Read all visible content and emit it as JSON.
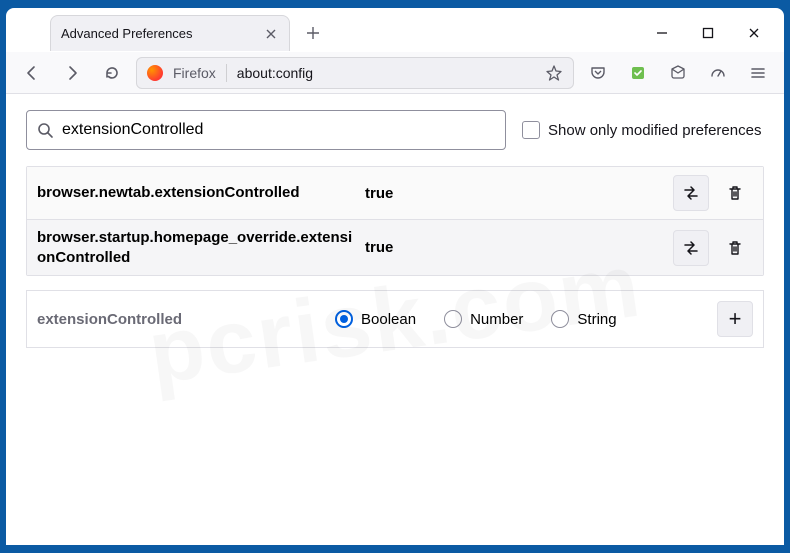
{
  "tab": {
    "title": "Advanced Preferences"
  },
  "urlbar": {
    "brand": "Firefox",
    "url": "about:config"
  },
  "search": {
    "value": "extensionControlled",
    "show_modified_label": "Show only modified preferences"
  },
  "prefs": [
    {
      "name": "browser.newtab.extensionControlled",
      "value": "true"
    },
    {
      "name": "browser.startup.homepage_override.extensionControlled",
      "value": "true"
    }
  ],
  "newpref": {
    "name": "extensionControlled",
    "options": {
      "boolean": "Boolean",
      "number": "Number",
      "string": "String"
    },
    "selected": "boolean"
  }
}
